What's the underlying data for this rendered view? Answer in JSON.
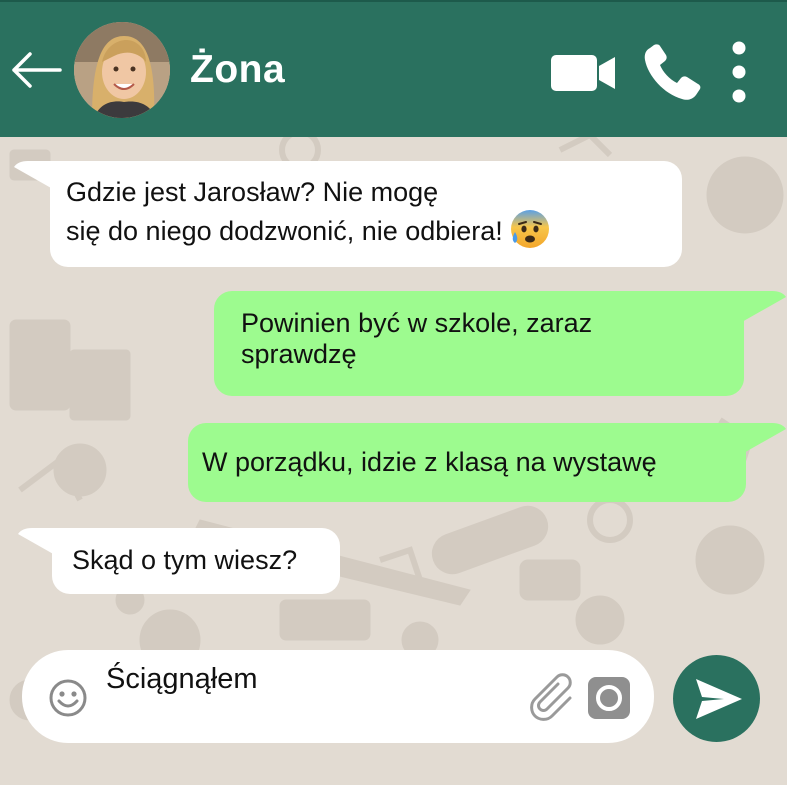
{
  "header": {
    "back_icon": "arrow-left-icon",
    "contact_name": "Żona",
    "video_icon": "video-camera-icon",
    "call_icon": "phone-icon",
    "menu_icon": "more-vertical-icon",
    "color": "#2a715f"
  },
  "messages": [
    {
      "direction": "incoming",
      "lines": [
        "Gdzie jest Jarosław? Nie mogę",
        "się do niego dodzwonić, nie odbiera!"
      ],
      "emoji": "anxious-face-with-sweat"
    },
    {
      "direction": "outgoing",
      "lines": [
        "Powinien być w szkole, zaraz",
        "sprawdzę"
      ]
    },
    {
      "direction": "outgoing",
      "lines": [
        "W porządku, idzie z klasą na wystawę"
      ]
    },
    {
      "direction": "incoming",
      "lines": [
        "Skąd o tym wiesz?"
      ]
    }
  ],
  "composer": {
    "emoji_icon": "smiley-icon",
    "text": "Ściągnąłem",
    "attach_icon": "paperclip-icon",
    "camera_icon": "camera-icon",
    "send_icon": "send-arrow-icon"
  },
  "colors": {
    "incoming_bubble": "#ffffff",
    "outgoing_bubble": "#9dfb8f",
    "wallpaper": "#e2dbd2"
  }
}
